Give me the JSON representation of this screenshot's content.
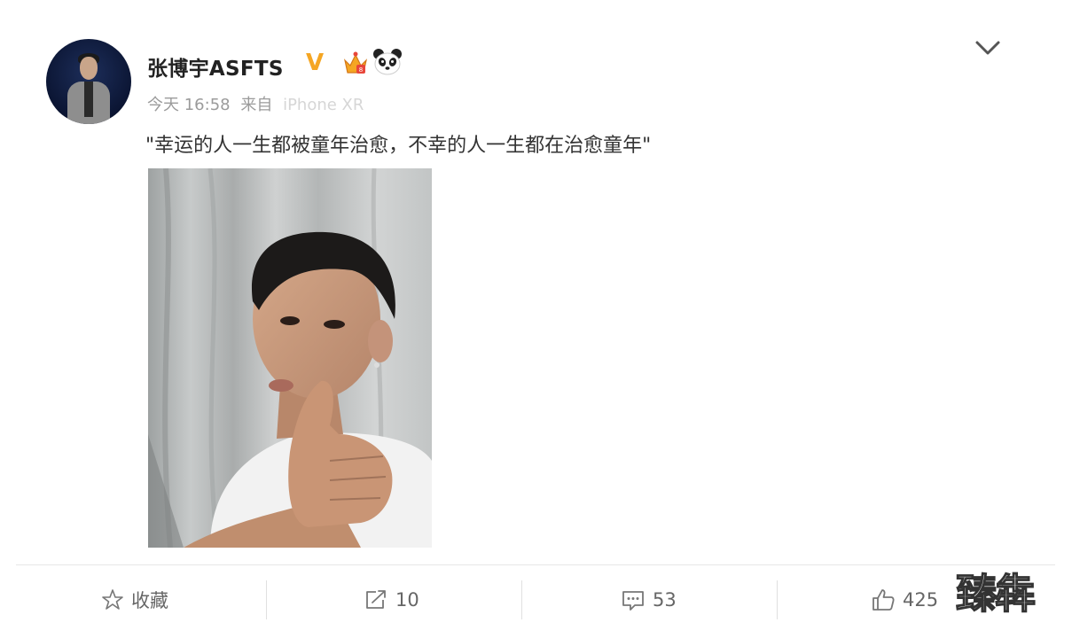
{
  "post": {
    "username": "张博宇ASFTS",
    "verified_badge": "V",
    "time": "今天 16:58",
    "source_prefix": "来自",
    "source": "iPhone XR",
    "text": "\"幸运的人一生都被童年治愈，不幸的人一生都在治愈童年\""
  },
  "actions": {
    "favorite_label": "收藏",
    "repost_count": "10",
    "comment_count": "53",
    "like_count": "425"
  },
  "icons": {
    "expand": "chevron-down-icon",
    "favorite": "star-outline-icon",
    "repost": "repost-icon",
    "comment": "comment-icon",
    "like": "thumbs-up-icon"
  },
  "watermark": "臻犇",
  "colors": {
    "verified": "#f5a623",
    "text": "#333333",
    "meta": "#9b9b9b",
    "action": "#666666"
  }
}
